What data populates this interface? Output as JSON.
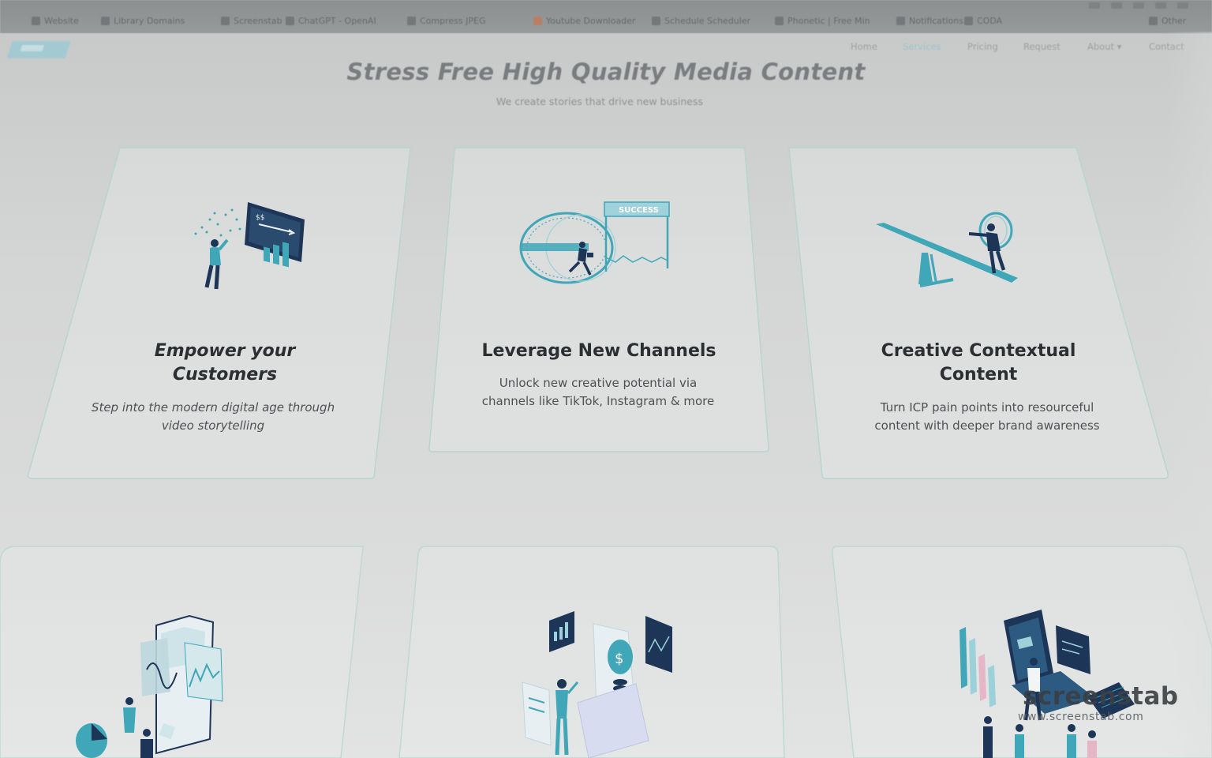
{
  "browser": {
    "top_hint": "",
    "bookmarks": [
      {
        "label": "Website",
        "icon": "globe-icon"
      },
      {
        "label": "Library Domains",
        "icon": "folder-icon"
      },
      {
        "label": "Screenstab",
        "icon": "page-icon"
      },
      {
        "label": "ChatGPT - OpenAI",
        "icon": "chat-icon"
      },
      {
        "label": "Compress JPEG",
        "icon": "search-icon"
      },
      {
        "label": "Youtube Downloader",
        "icon": "warn-icon"
      },
      {
        "label": "Schedule Scheduler",
        "icon": "calendar-icon"
      },
      {
        "label": "Phonetic | Free Min",
        "icon": "globe-icon"
      },
      {
        "label": "Notifications",
        "icon": "list-icon"
      },
      {
        "label": "CODA",
        "icon": "doc-icon"
      },
      {
        "label": "Other",
        "icon": "folder-icon"
      }
    ]
  },
  "nav": {
    "items": [
      {
        "label": "Home",
        "active": false
      },
      {
        "label": "Services",
        "active": true
      },
      {
        "label": "Pricing",
        "active": false
      },
      {
        "label": "Request",
        "active": false
      },
      {
        "label": "About ▾",
        "active": false
      },
      {
        "label": "Contact",
        "active": false
      }
    ]
  },
  "hero": {
    "title": "Stress Free High Quality Media Content",
    "subtitle": "We create stories that drive new business"
  },
  "cards": [
    {
      "title": "Empower your Customers",
      "title_l1": "Empower your",
      "title_l2": "Customers",
      "text_l1": "Step into the modern digital age through",
      "text_l2": "video storytelling",
      "icon": "growth-chart-illustration"
    },
    {
      "title": "Leverage New Channels",
      "text_l1": "Unlock new creative potential via",
      "text_l2": "channels like TikTok, Instagram & more",
      "icon": "hamster-wheel-success-illustration",
      "banner": "SUCCESS"
    },
    {
      "title": "Creative Contextual Content",
      "title_l1": "Creative Contextual",
      "title_l2": "Content",
      "text_l1": "Turn ICP pain points into resourceful",
      "text_l2": "content with deeper brand awareness",
      "icon": "seesaw-illustration"
    }
  ],
  "watermark": {
    "name": "screenstab",
    "url": "www.screenstab.com"
  },
  "colors": {
    "accent": "#3fa7b8",
    "card_border": "#b3d3cf",
    "title": "#2c2f32"
  }
}
